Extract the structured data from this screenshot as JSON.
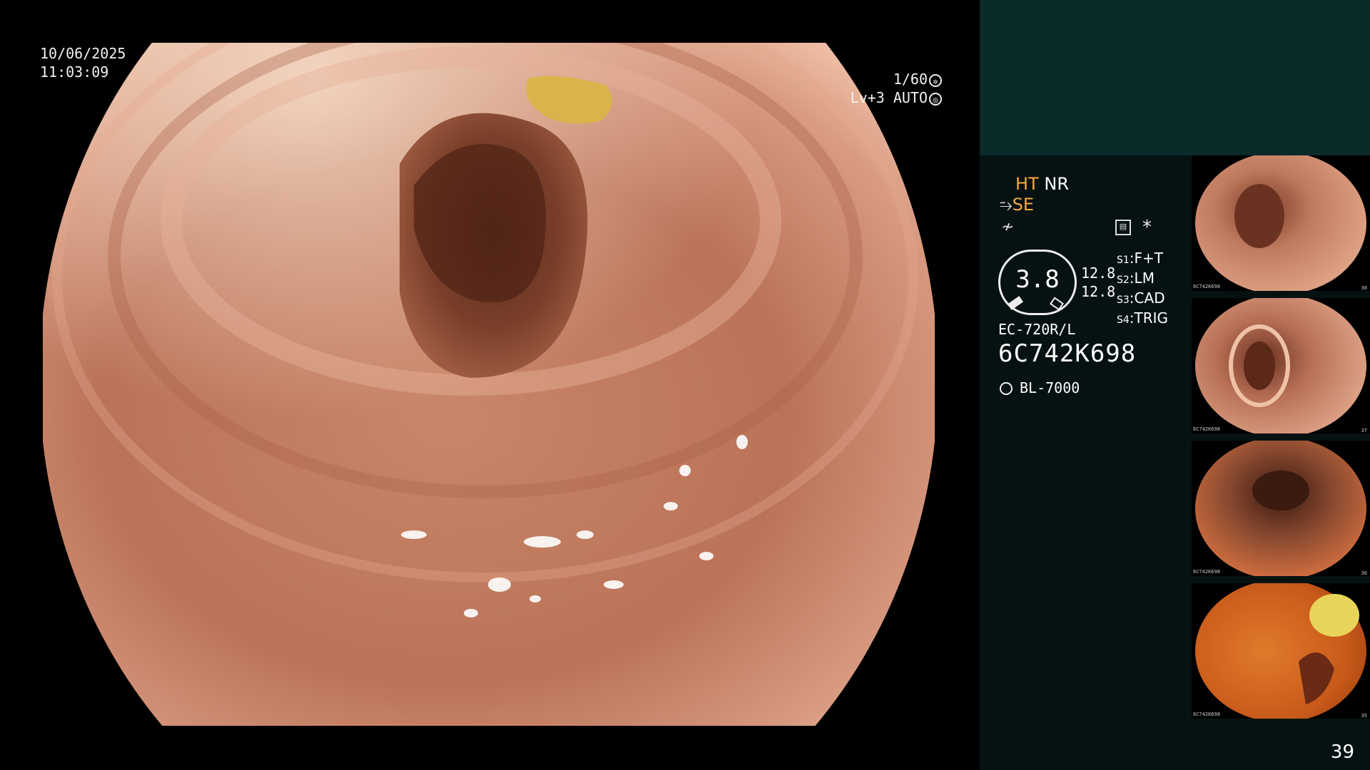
{
  "viewer": {
    "date": "10/06/2025",
    "time": "11:03:09",
    "shutter": "1/60",
    "shutter_icon": "shutter-icon",
    "level": "Lv+3",
    "iris": "AUTO",
    "iris_icon": "iris-icon"
  },
  "panel": {
    "ht_label": "HT",
    "nr_label": "NR",
    "se_label": "SE",
    "feed_symbol": "≁",
    "star": "*",
    "gauge_value": "3.8",
    "gauge_top": "12.8",
    "gauge_bottom": "12.8",
    "slots": [
      {
        "key": "S1",
        "value": "F+T"
      },
      {
        "key": "S2",
        "value": "LM"
      },
      {
        "key": "S3",
        "value": "CAD"
      },
      {
        "key": "S4",
        "value": "TRIG"
      }
    ],
    "scope_model": "EC-720R/L",
    "scope_serial": "6C742K698",
    "light_source": "BL-7000",
    "page_number": "39"
  },
  "thumbnails": [
    {
      "serial": "6C742K698",
      "index": "38"
    },
    {
      "serial": "6C742K698",
      "index": "37"
    },
    {
      "serial": "6C742K698",
      "index": "36"
    },
    {
      "serial": "6C742K698",
      "index": "35"
    }
  ],
  "colors": {
    "panel_bg": "#061212",
    "panel_top": "#0b2a2a",
    "highlight": "#f4a93a",
    "mucosa": "#c07a5e"
  }
}
